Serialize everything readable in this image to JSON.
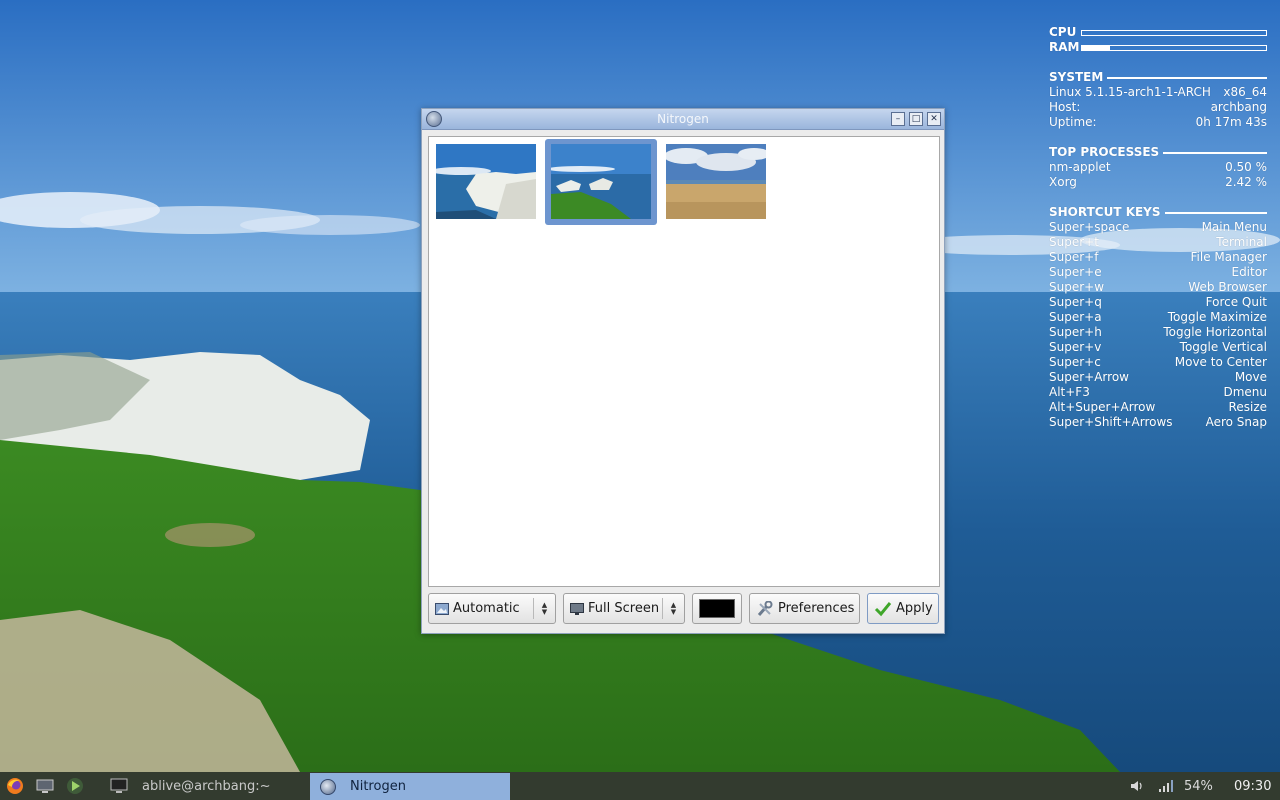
{
  "conky": {
    "meters": [
      {
        "label": "CPU",
        "level": 0.0
      },
      {
        "label": "RAM",
        "level": 0.15
      }
    ],
    "system": {
      "title": "SYSTEM",
      "kernel": "Linux 5.1.15-arch1-1-ARCH",
      "arch": "x86_64",
      "host_label": "Host:",
      "host_value": "archbang",
      "uptime_label": "Uptime:",
      "uptime_value": "0h 17m 43s"
    },
    "top_processes": {
      "title": "TOP PROCESSES",
      "rows": [
        {
          "name": "nm-applet",
          "value": "0.50 %"
        },
        {
          "name": "Xorg",
          "value": "2.42 %"
        }
      ]
    },
    "shortcuts": {
      "title": "SHORTCUT KEYS",
      "rows": [
        {
          "key": "Super+space",
          "action": "Main Menu"
        },
        {
          "key": "Super+t",
          "action": "Terminal"
        },
        {
          "key": "Super+f",
          "action": "File Manager"
        },
        {
          "key": "Super+e",
          "action": "Editor"
        },
        {
          "key": "Super+w",
          "action": "Web Browser"
        },
        {
          "key": "Super+q",
          "action": "Force Quit"
        },
        {
          "key": "Super+a",
          "action": "Toggle Maximize"
        },
        {
          "key": "Super+h",
          "action": "Toggle Horizontal"
        },
        {
          "key": "Super+v",
          "action": "Toggle Vertical"
        },
        {
          "key": "Super+c",
          "action": "Move to Center"
        },
        {
          "key": "Super+Arrow",
          "action": "Move"
        },
        {
          "key": "Alt+F3",
          "action": "Dmenu"
        },
        {
          "key": "Alt+Super+Arrow",
          "action": "Resize"
        },
        {
          "key": "Super+Shift+Arrows",
          "action": "Aero Snap"
        }
      ]
    }
  },
  "window": {
    "title": "Nitrogen",
    "buttons": {
      "minimize": "–",
      "maximize": "□",
      "close": "✕"
    },
    "thumbnails": [
      {
        "name": "cliff-sea-thumbnail",
        "selected": false
      },
      {
        "name": "cliff-grass-thumbnail",
        "selected": true
      },
      {
        "name": "beach-sky-thumbnail",
        "selected": false
      }
    ],
    "mode_select": "Automatic",
    "size_select": "Full Screen",
    "bg_color": "#000000",
    "preferences_label": "Preferences",
    "apply_label": "Apply"
  },
  "taskbar": {
    "launchers": [
      "firefox-icon",
      "desktop-icon",
      "play-icon"
    ],
    "task_terminal": "ablive@archbang:~",
    "task_active": "Nitrogen",
    "battery": "54%",
    "clock": "09:30"
  },
  "colors": {
    "accent": "#8fb0dc",
    "titlebar": "#9ab5dc",
    "taskbar": "#333b2f"
  }
}
